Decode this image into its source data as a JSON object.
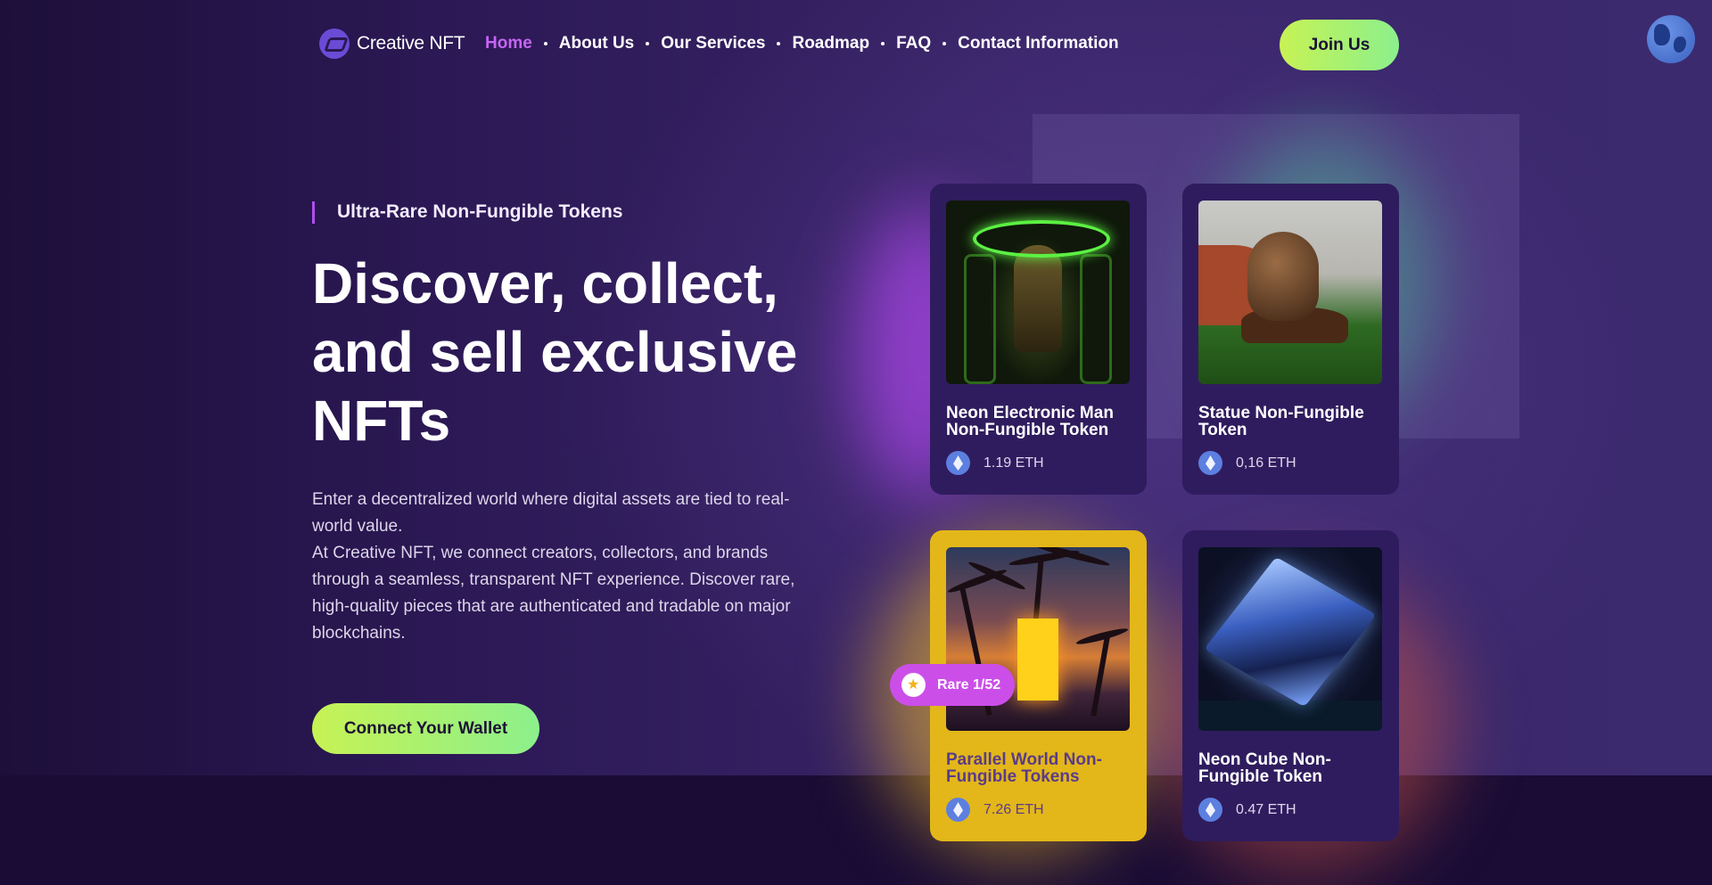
{
  "header": {
    "logo_text": "Creative NFT",
    "nav": [
      {
        "label": "Home",
        "active": true
      },
      {
        "label": "About Us"
      },
      {
        "label": "Our Services"
      },
      {
        "label": "Roadmap"
      },
      {
        "label": "FAQ"
      },
      {
        "label": "Contact Information"
      }
    ],
    "join_label": "Join Us",
    "language_icon": "globe-icon"
  },
  "hero": {
    "eyebrow": "Ultra-Rare Non-Fungible Tokens",
    "headline": "Discover, collect, and sell exclusive NFTs",
    "intro_line1": "Enter a decentralized world where digital assets are tied to real-world value.",
    "intro_line2": "At Creative NFT, we connect creators, collectors, and brands through a seamless, transparent NFT experience. Discover rare, high-quality pieces that are authenticated and tradable on major blockchains.",
    "cta_label": "Connect Your Wallet"
  },
  "cards": [
    {
      "title": "Neon Electronic Man Non-Fungible Token",
      "price": "1.19 ETH"
    },
    {
      "title": "Statue Non-Fungible Token",
      "price": "0,16 ETH"
    },
    {
      "title": "Parallel World Non-Fungible Tokens",
      "price": "7.26 ETH"
    },
    {
      "title": "Neon Cube Non-Fungible Token",
      "price": "0.47 ETH"
    }
  ],
  "rare_badge": "Rare 1/52",
  "colors": {
    "accent_purple": "#c765f2",
    "button_gradient_start": "#c7f254",
    "button_gradient_end": "#8cf08c",
    "card_bg": "#2f1c5e",
    "featured_card_bg": "#e3b719",
    "badge_bg": "#cc4ee9"
  }
}
